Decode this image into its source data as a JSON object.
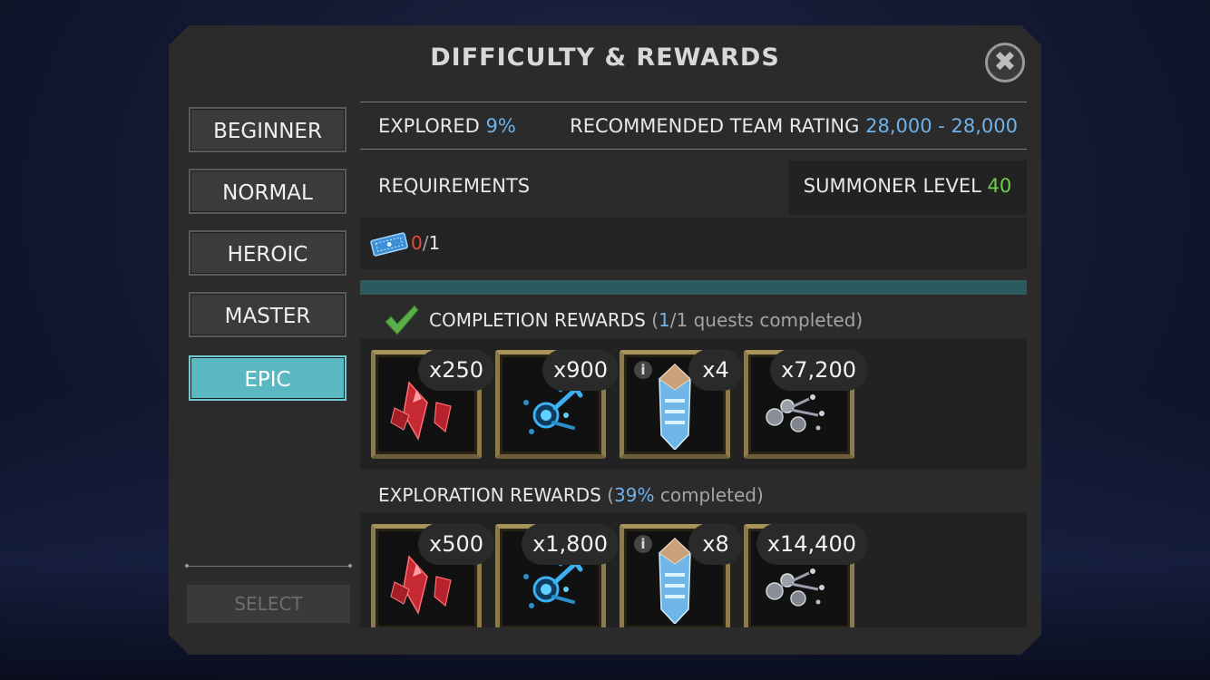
{
  "title": "DIFFICULTY & REWARDS",
  "close_label": "✖",
  "difficulties": [
    {
      "label": "BEGINNER",
      "active": false
    },
    {
      "label": "NORMAL",
      "active": false
    },
    {
      "label": "HEROIC",
      "active": false
    },
    {
      "label": "MASTER",
      "active": false
    },
    {
      "label": "EPIC",
      "active": true
    }
  ],
  "select_label": "SELECT",
  "explored": {
    "label": "EXPLORED",
    "value": "9%"
  },
  "team_rating": {
    "label": "RECOMMENDED TEAM RATING",
    "value": "28,000 - 28,000"
  },
  "requirements": {
    "label": "REQUIREMENTS",
    "summoner_label": "SUMMONER LEVEL",
    "summoner_value": "40",
    "ticket_have": "0",
    "ticket_sep": "/",
    "ticket_need": "1"
  },
  "completion": {
    "label": "COMPLETION REWARDS",
    "open": "(",
    "done": "1",
    "rest": "/1 quests completed)",
    "rewards": [
      {
        "count": "x250",
        "icon": "red-crystal-shards-icon"
      },
      {
        "count": "x900",
        "icon": "blue-catalyst-icon"
      },
      {
        "count": "x4",
        "icon": "crystal-icon",
        "info": "i"
      },
      {
        "count": "x7,200",
        "icon": "silver-orbs-icon"
      }
    ]
  },
  "exploration": {
    "label": "EXPLORATION REWARDS",
    "open": "(",
    "pct": "39%",
    "rest": " completed)",
    "rewards": [
      {
        "count": "x500",
        "icon": "red-crystal-shards-icon"
      },
      {
        "count": "x1,800",
        "icon": "blue-catalyst-icon"
      },
      {
        "count": "x8",
        "icon": "crystal-icon",
        "info": "i"
      },
      {
        "count": "x14,400",
        "icon": "silver-orbs-icon"
      }
    ]
  },
  "colors": {
    "accent": "#5ab8c2",
    "value_blue": "#6fb1e8",
    "value_green": "#69d24a",
    "value_red": "#e5493a"
  }
}
